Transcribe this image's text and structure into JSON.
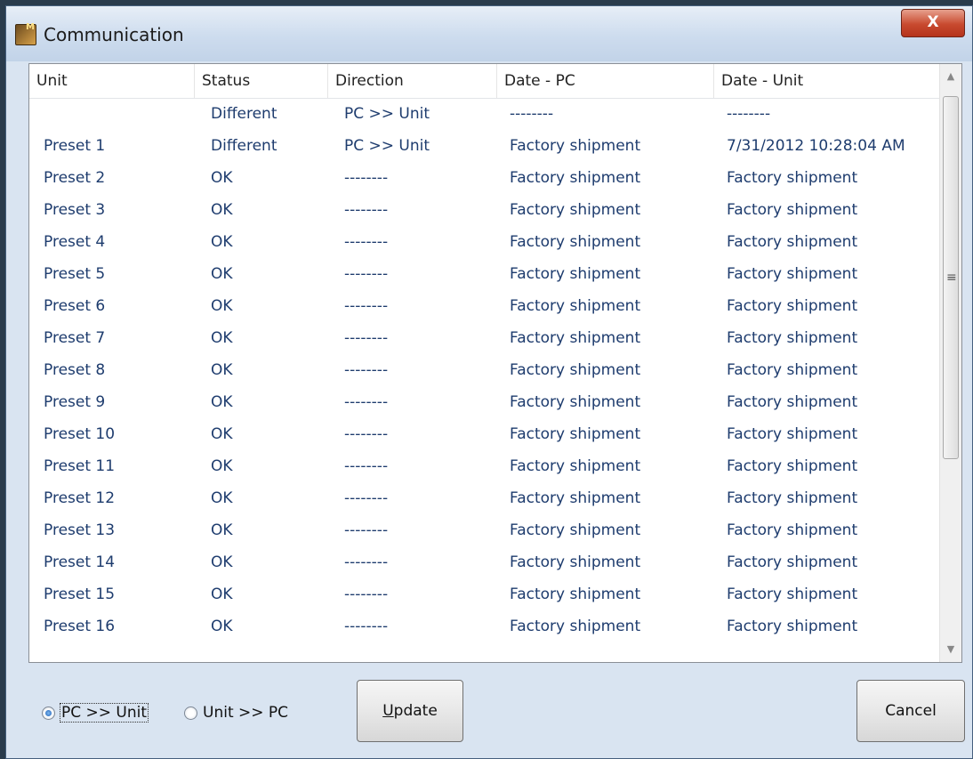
{
  "window": {
    "title": "Communication",
    "close_label": "X"
  },
  "table": {
    "columns": [
      "Unit",
      "Status",
      "Direction",
      "Date - PC",
      "Date - Unit"
    ],
    "rows": [
      [
        "",
        "Different",
        "PC >> Unit",
        "--------",
        "--------"
      ],
      [
        "Preset 1",
        "Different",
        "PC >> Unit",
        "Factory shipment",
        "7/31/2012 10:28:04 AM"
      ],
      [
        "Preset 2",
        "OK",
        "--------",
        "Factory shipment",
        "Factory shipment"
      ],
      [
        "Preset 3",
        "OK",
        "--------",
        "Factory shipment",
        "Factory shipment"
      ],
      [
        "Preset 4",
        "OK",
        "--------",
        "Factory shipment",
        "Factory shipment"
      ],
      [
        "Preset 5",
        "OK",
        "--------",
        "Factory shipment",
        "Factory shipment"
      ],
      [
        "Preset 6",
        "OK",
        "--------",
        "Factory shipment",
        "Factory shipment"
      ],
      [
        "Preset 7",
        "OK",
        "--------",
        "Factory shipment",
        "Factory shipment"
      ],
      [
        "Preset 8",
        "OK",
        "--------",
        "Factory shipment",
        "Factory shipment"
      ],
      [
        "Preset 9",
        "OK",
        "--------",
        "Factory shipment",
        "Factory shipment"
      ],
      [
        "Preset 10",
        "OK",
        "--------",
        "Factory shipment",
        "Factory shipment"
      ],
      [
        "Preset 11",
        "OK",
        "--------",
        "Factory shipment",
        "Factory shipment"
      ],
      [
        "Preset 12",
        "OK",
        "--------",
        "Factory shipment",
        "Factory shipment"
      ],
      [
        "Preset 13",
        "OK",
        "--------",
        "Factory shipment",
        "Factory shipment"
      ],
      [
        "Preset 14",
        "OK",
        "--------",
        "Factory shipment",
        "Factory shipment"
      ],
      [
        "Preset 15",
        "OK",
        "--------",
        "Factory shipment",
        "Factory shipment"
      ],
      [
        "Preset 16",
        "OK",
        "--------",
        "Factory shipment",
        "Factory shipment"
      ]
    ]
  },
  "direction_options": [
    {
      "label": "PC >> Unit",
      "checked": true
    },
    {
      "label": "Unit >> PC",
      "checked": false
    }
  ],
  "buttons": {
    "update": "Update",
    "cancel": "Cancel"
  },
  "icons": {
    "app": "app-logo-icon",
    "close": "close-icon",
    "scroll_up": "scroll-up-arrow-icon",
    "scroll_down": "scroll-down-arrow-icon"
  }
}
